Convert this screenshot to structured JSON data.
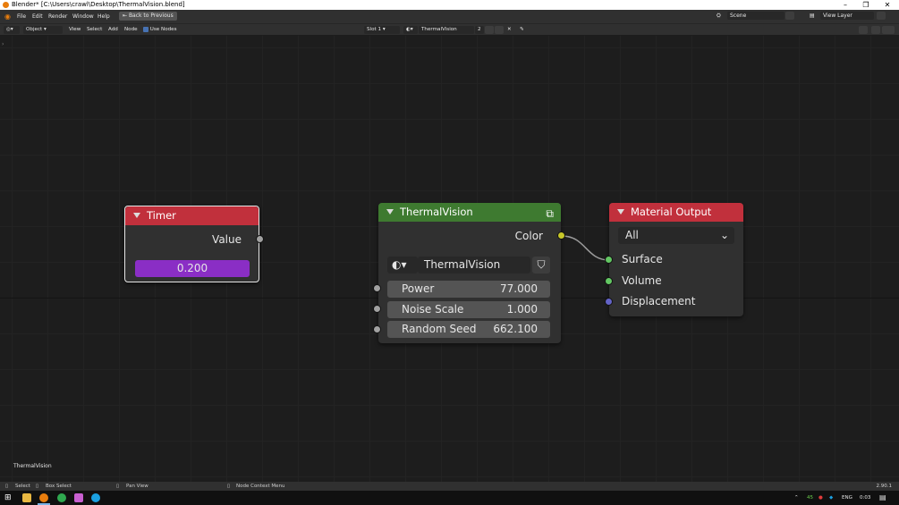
{
  "window": {
    "title": "Blender* [C:\\Users\\crawl\\Desktop\\ThermalVision.blend]",
    "controls": [
      "–",
      "❐",
      "✕"
    ]
  },
  "menubar": {
    "items": [
      "File",
      "Edit",
      "Render",
      "Window",
      "Help"
    ],
    "back_button": "Back to Previous",
    "scene_label": "Scene",
    "view_layer_label": "View Layer"
  },
  "header": {
    "mode": "Object",
    "menus": [
      "View",
      "Select",
      "Add",
      "Node"
    ],
    "use_nodes_label": "Use Nodes",
    "slot": "Slot 1",
    "material_name": "ThermalVision",
    "user_count": "2"
  },
  "nodes": {
    "timer": {
      "title": "Timer",
      "output_label": "Value",
      "value": "0.200",
      "color": "#c1303c"
    },
    "thermal": {
      "title": "ThermalVision",
      "output_label": "Color",
      "group_name": "ThermalVision",
      "color": "#3e7a30",
      "inputs": [
        {
          "label": "Power",
          "value": "77.000"
        },
        {
          "label": "Noise Scale",
          "value": "1.000"
        },
        {
          "label": "Random Seed",
          "value": "662.100"
        }
      ]
    },
    "output": {
      "title": "Material Output",
      "color": "#c1303c",
      "target": "All",
      "inputs": [
        "Surface",
        "Volume",
        "Displacement"
      ]
    }
  },
  "canvas": {
    "material_label": "ThermalVision"
  },
  "statusbar": {
    "select": "Select",
    "box_select": "Box Select",
    "pan_view": "Pan View",
    "context_menu": "Node Context Menu",
    "version": "2.90.1"
  },
  "taskbar": {
    "lang": "ENG",
    "time": "0:03",
    "tray_number": "45"
  }
}
